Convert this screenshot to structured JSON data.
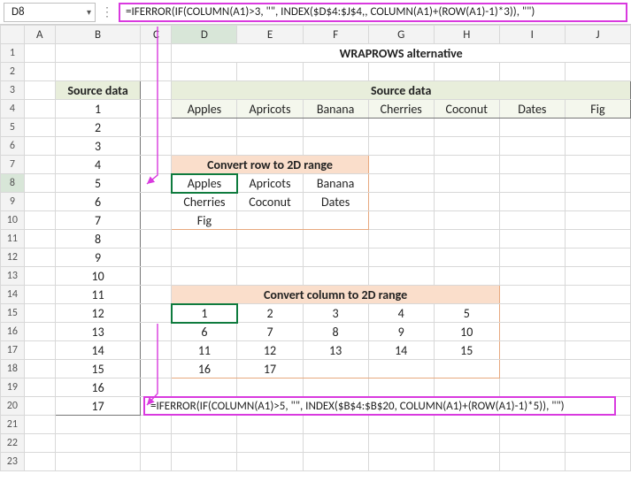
{
  "nameBox": "D8",
  "formulaBar": "=IFERROR(IF(COLUMN(A1)>3, \"\", INDEX($D$4:$J$4,, COLUMN(A1)+(ROW(A1)-1)*3)), \"\")",
  "columnHeaders": [
    "A",
    "B",
    "C",
    "D",
    "E",
    "F",
    "G",
    "H",
    "I",
    "J"
  ],
  "title": "WRAPROWS alternative",
  "srcHeader": "Source data",
  "srcColumn": [
    "1",
    "2",
    "3",
    "4",
    "5",
    "6",
    "7",
    "8",
    "9",
    "10",
    "11",
    "12",
    "13",
    "14",
    "15",
    "16",
    "17"
  ],
  "srcRowHeader": "Source data",
  "srcRow": [
    "Apples",
    "Apricots",
    "Banana",
    "Cherries",
    "Coconut",
    "Dates",
    "Fig"
  ],
  "block1Title": "Convert row to 2D range",
  "block1": [
    [
      "Apples",
      "Apricots",
      "Banana"
    ],
    [
      "Cherries",
      "Coconut",
      "Dates"
    ],
    [
      "Fig",
      "",
      ""
    ]
  ],
  "block2Title": "Convert column to 2D range",
  "block2": [
    [
      "1",
      "2",
      "3",
      "4",
      "5"
    ],
    [
      "6",
      "7",
      "8",
      "9",
      "10"
    ],
    [
      "11",
      "12",
      "13",
      "14",
      "15"
    ],
    [
      "16",
      "17",
      "",
      "",
      ""
    ]
  ],
  "formulaBottom": "=IFERROR(IF(COLUMN(A1)>5, \"\", INDEX($B$4:$B$20, COLUMN(A1)+(ROW(A1)-1)*5)), \"\")",
  "chart_data": {
    "type": "table",
    "note": "Spreadsheet showing WRAPROWS alternative formulas converting a 1D source row and column into 2D ranges",
    "source_column_B4_B20": [
      1,
      2,
      3,
      4,
      5,
      6,
      7,
      8,
      9,
      10,
      11,
      12,
      13,
      14,
      15,
      16,
      17
    ],
    "source_row_D4_J4": [
      "Apples",
      "Apricots",
      "Banana",
      "Cherries",
      "Coconut",
      "Dates",
      "Fig"
    ],
    "row_to_2d_D8_F10": [
      [
        "Apples",
        "Apricots",
        "Banana"
      ],
      [
        "Cherries",
        "Coconut",
        "Dates"
      ],
      [
        "Fig",
        "",
        ""
      ]
    ],
    "col_to_2d_D15_H18": [
      [
        1,
        2,
        3,
        4,
        5
      ],
      [
        6,
        7,
        8,
        9,
        10
      ],
      [
        11,
        12,
        13,
        14,
        15
      ],
      [
        16,
        17,
        "",
        "",
        ""
      ]
    ],
    "formula_D8": "=IFERROR(IF(COLUMN(A1)>3, \"\", INDEX($D$4:$J$4,, COLUMN(A1)+(ROW(A1)-1)*3)), \"\")",
    "formula_D15": "=IFERROR(IF(COLUMN(A1)>5, \"\", INDEX($B$4:$B$20, COLUMN(A1)+(ROW(A1)-1)*5)), \"\")"
  }
}
